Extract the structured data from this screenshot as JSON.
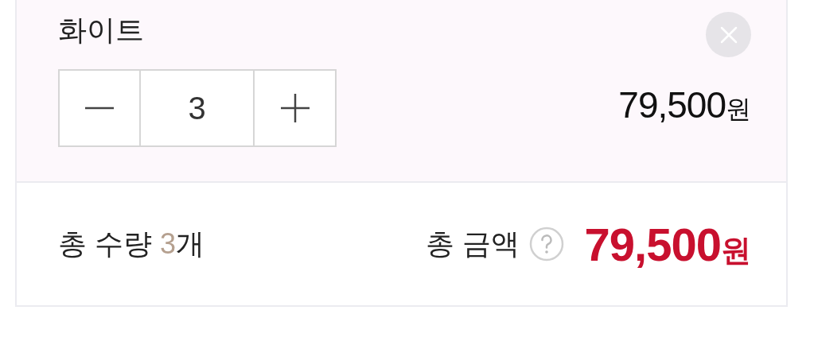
{
  "option": {
    "name": "화이트",
    "quantity": "3",
    "price": "79,500",
    "price_unit": "원"
  },
  "summary": {
    "quantity_label": "총 수량",
    "quantity": "3",
    "quantity_unit": "개",
    "amount_label": "총 금액",
    "amount": "79,500",
    "amount_unit": "원"
  }
}
